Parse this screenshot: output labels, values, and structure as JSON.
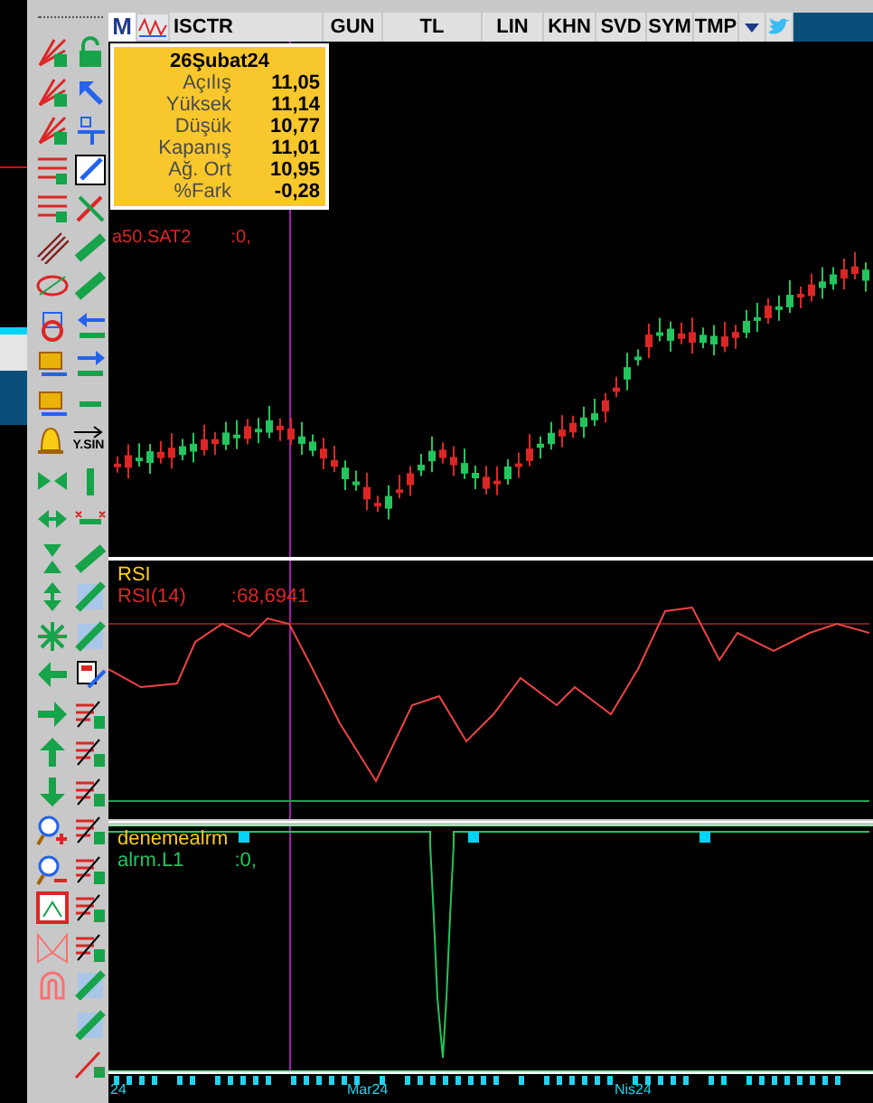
{
  "header": {
    "logo": "M",
    "buttons": [
      "ISCTR",
      "GUN",
      "TL",
      "LIN",
      "KHN",
      "SVD",
      "SYM",
      "TMP"
    ]
  },
  "toolbar": {
    "label": "Y.SIN"
  },
  "info_box": {
    "date": "26Şubat24",
    "rows": [
      {
        "label": "Açılış",
        "value": "11,05"
      },
      {
        "label": "Yüksek",
        "value": "11,14"
      },
      {
        "label": "Düşük",
        "value": "10,77"
      },
      {
        "label": "Kapanış",
        "value": "11,01"
      },
      {
        "label": "Ağ. Ort",
        "value": "10,95"
      },
      {
        "label": "%Fark",
        "value": "-0,28"
      }
    ]
  },
  "price_panel": {
    "series": "a50.SAT2",
    "reading": ":0,"
  },
  "rsi_panel": {
    "title": "RSI",
    "series": "RSI(14)",
    "reading": ":68,6941"
  },
  "alarm_panel": {
    "title": "denemealrm",
    "series": "alrm.L1",
    "reading": ":0,"
  },
  "date_axis": {
    "labels": [
      "24",
      "Mar24",
      "Nis24"
    ]
  }
}
